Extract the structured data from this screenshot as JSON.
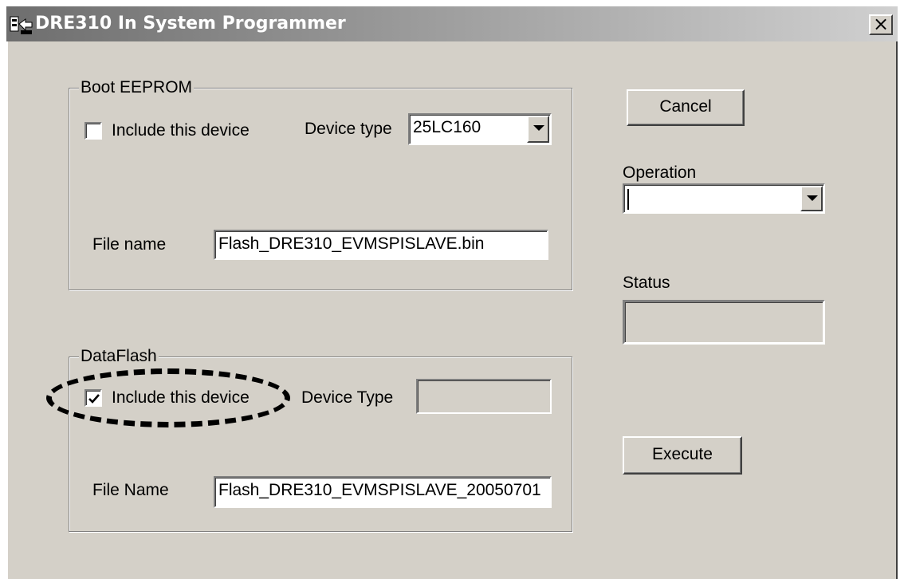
{
  "window": {
    "title": "DRE310 In System Programmer",
    "close_glyph": "×"
  },
  "boot_eeprom": {
    "group_label": "Boot EEPROM",
    "include_label": "Include this device",
    "include_checked": false,
    "device_type_label": "Device type",
    "device_type_value": "25LC160",
    "file_name_label": "File name",
    "file_name_value": "Flash_DRE310_EVMSPISLAVE.bin"
  },
  "dataflash": {
    "group_label": "DataFlash",
    "include_label": "Include this device",
    "include_checked": true,
    "device_type_label": "Device Type",
    "device_type_value": "",
    "file_name_label": "File Name",
    "file_name_value": "Flash_DRE310_EVMSPISLAVE_20050701"
  },
  "actions": {
    "cancel_label": "Cancel",
    "operation_label": "Operation",
    "operation_value": "",
    "status_label": "Status",
    "status_value": "",
    "execute_label": "Execute"
  },
  "icons": {
    "app_icon": "programmer-app-icon",
    "dropdown_icon": "chevron-down-icon",
    "checkmark_icon": "checkmark-icon"
  },
  "colors": {
    "window_bg": "#d4d0c8",
    "titlebar_start": "#6e6e6e",
    "titlebar_end": "#d0d0d0"
  }
}
